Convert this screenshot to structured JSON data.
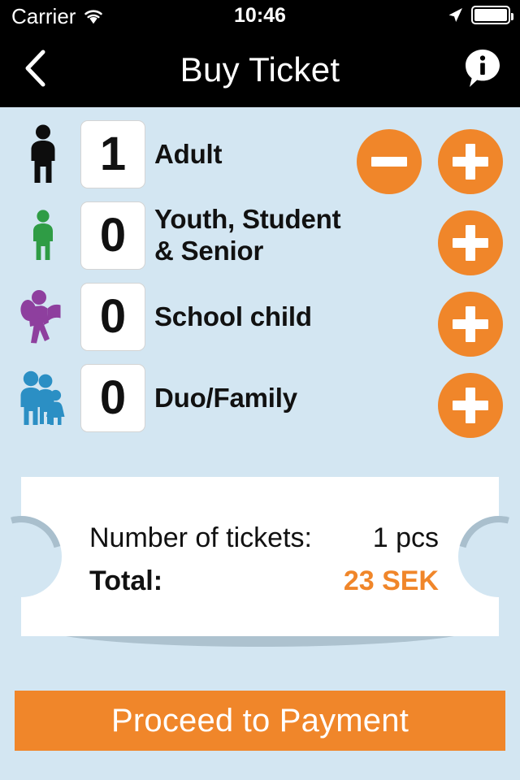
{
  "status_bar": {
    "carrier": "Carrier",
    "time": "10:46",
    "wifi_icon": "wifi-icon",
    "location_icon": "location-arrow-icon",
    "battery_icon": "battery-full-icon"
  },
  "nav": {
    "back_icon": "chevron-left-icon",
    "title": "Buy Ticket",
    "info_icon": "info-bubble-icon"
  },
  "colors": {
    "background": "#d3e6f2",
    "accent_orange": "#f0862a",
    "navbar": "#000000",
    "card": "#ffffff",
    "adult_icon": "#0d0d0d",
    "youth_icon": "#2f9c45",
    "school_icon": "#8e3f9e",
    "family_icon": "#2b8fc4"
  },
  "ticket_rows": [
    {
      "id": "adult",
      "icon": "person-adult-icon",
      "icon_color": "#0d0d0d",
      "quantity": "1",
      "label": "Adult",
      "has_minus": true,
      "has_plus": true,
      "minus_label": "−",
      "plus_label": "+"
    },
    {
      "id": "youth-student-senior",
      "icon": "person-youth-icon",
      "icon_color": "#2f9c45",
      "quantity": "0",
      "label": "Youth, Student & Senior",
      "label_line1": "Youth, Student",
      "label_line2": "& Senior",
      "has_minus": false,
      "has_plus": true,
      "plus_label": "+"
    },
    {
      "id": "school-child",
      "icon": "person-schoolchild-icon",
      "icon_color": "#8e3f9e",
      "quantity": "0",
      "label": "School child",
      "has_minus": false,
      "has_plus": true,
      "plus_label": "+"
    },
    {
      "id": "duo-family",
      "icon": "people-family-icon",
      "icon_color": "#2b8fc4",
      "quantity": "0",
      "label": "Duo/Family",
      "has_minus": false,
      "has_plus": true,
      "plus_label": "+"
    }
  ],
  "summary": {
    "count_label": "Number of tickets:",
    "count_value": "1 pcs",
    "total_label": "Total:",
    "total_value": "23 SEK"
  },
  "actions": {
    "proceed_label": "Proceed to Payment"
  }
}
